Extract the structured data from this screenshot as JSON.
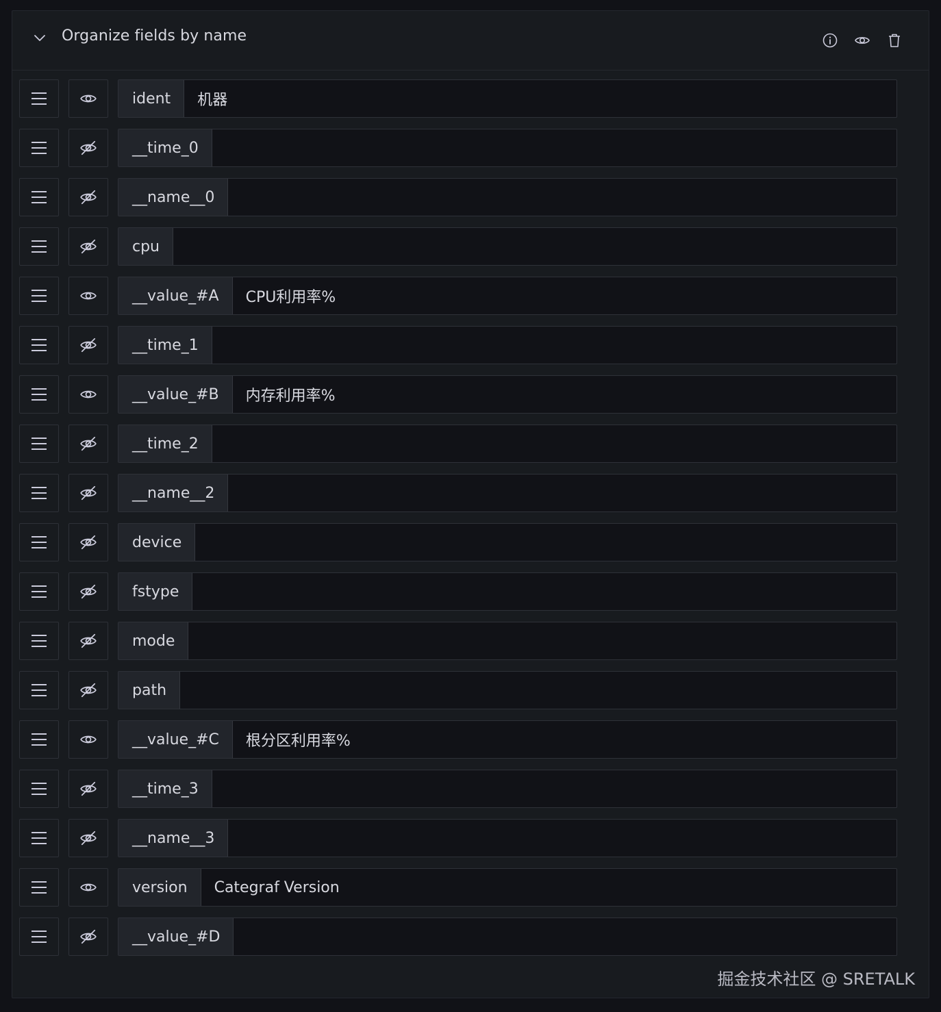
{
  "transform": {
    "title": "Organize fields by name"
  },
  "header_actions": [
    "info-icon",
    "eye-icon",
    "trash-icon"
  ],
  "fields": [
    {
      "name": "ident",
      "rename": "机器",
      "visible": true
    },
    {
      "name": "__time_0",
      "rename": "",
      "visible": false
    },
    {
      "name": "__name__0",
      "rename": "",
      "visible": false
    },
    {
      "name": "cpu",
      "rename": "",
      "visible": false
    },
    {
      "name": "__value_#A",
      "rename": "CPU利用率%",
      "visible": true
    },
    {
      "name": "__time_1",
      "rename": "",
      "visible": false
    },
    {
      "name": "__value_#B",
      "rename": "内存利用率%",
      "visible": true
    },
    {
      "name": "__time_2",
      "rename": "",
      "visible": false
    },
    {
      "name": "__name__2",
      "rename": "",
      "visible": false
    },
    {
      "name": "device",
      "rename": "",
      "visible": false
    },
    {
      "name": "fstype",
      "rename": "",
      "visible": false
    },
    {
      "name": "mode",
      "rename": "",
      "visible": false
    },
    {
      "name": "path",
      "rename": "",
      "visible": false
    },
    {
      "name": "__value_#C",
      "rename": "根分区利用率%",
      "visible": true
    },
    {
      "name": "__time_3",
      "rename": "",
      "visible": false
    },
    {
      "name": "__name__3",
      "rename": "",
      "visible": false
    },
    {
      "name": "version",
      "rename": "Categraf Version",
      "visible": true
    },
    {
      "name": "__value_#D",
      "rename": "",
      "visible": false
    }
  ],
  "watermark": "掘金技术社区 @ SRETALK",
  "colors": {
    "page_bg": "#111217",
    "panel_bg": "#181b1f",
    "border": "#2e3138",
    "label_bg": "#22252b",
    "text": "#d8d9e0"
  }
}
